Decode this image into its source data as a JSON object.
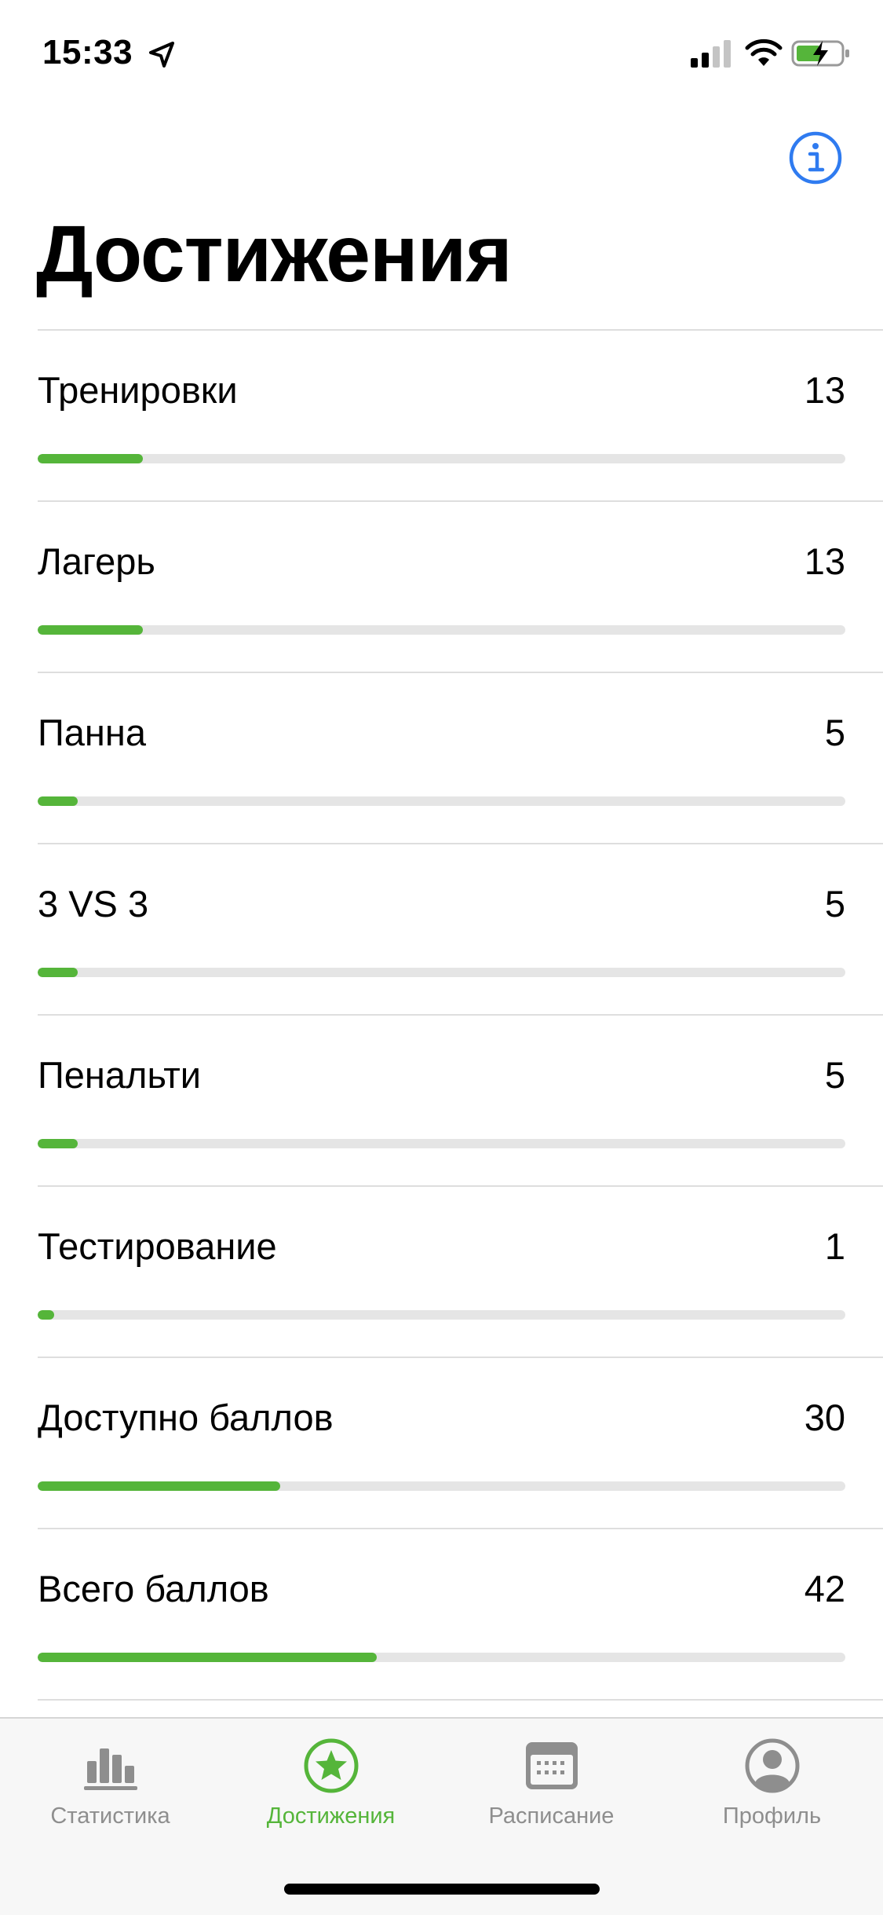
{
  "status_bar": {
    "time": "15:33",
    "icons": [
      "location-arrow-icon",
      "signal-icon",
      "wifi-icon",
      "battery-charging-icon"
    ]
  },
  "header": {
    "info_icon": "info-icon",
    "title": "Достижения"
  },
  "achievements": [
    {
      "label": "Тренировки",
      "value": "13",
      "progress": 0.13
    },
    {
      "label": "Лагерь",
      "value": "13",
      "progress": 0.13
    },
    {
      "label": "Панна",
      "value": "5",
      "progress": 0.05
    },
    {
      "label": "3 VS 3",
      "value": "5",
      "progress": 0.05
    },
    {
      "label": "Пенальти",
      "value": "5",
      "progress": 0.05
    },
    {
      "label": "Тестирование",
      "value": "1",
      "progress": 0.02
    },
    {
      "label": "Доступно баллов",
      "value": "30",
      "progress": 0.3
    },
    {
      "label": "Всего баллов",
      "value": "42",
      "progress": 0.42
    }
  ],
  "tab_bar": {
    "tabs": [
      {
        "label": "Статистика",
        "icon": "bar-chart-icon",
        "active": false
      },
      {
        "label": "Достижения",
        "icon": "star-circle-icon",
        "active": true
      },
      {
        "label": "Расписание",
        "icon": "calendar-icon",
        "active": false
      },
      {
        "label": "Профиль",
        "icon": "profile-icon",
        "active": false
      }
    ]
  },
  "colors": {
    "accent_green": "#55b53a",
    "info_blue": "#2f7bf0",
    "inactive_gray": "#8e8e8e",
    "track_gray": "#e5e5e5"
  }
}
